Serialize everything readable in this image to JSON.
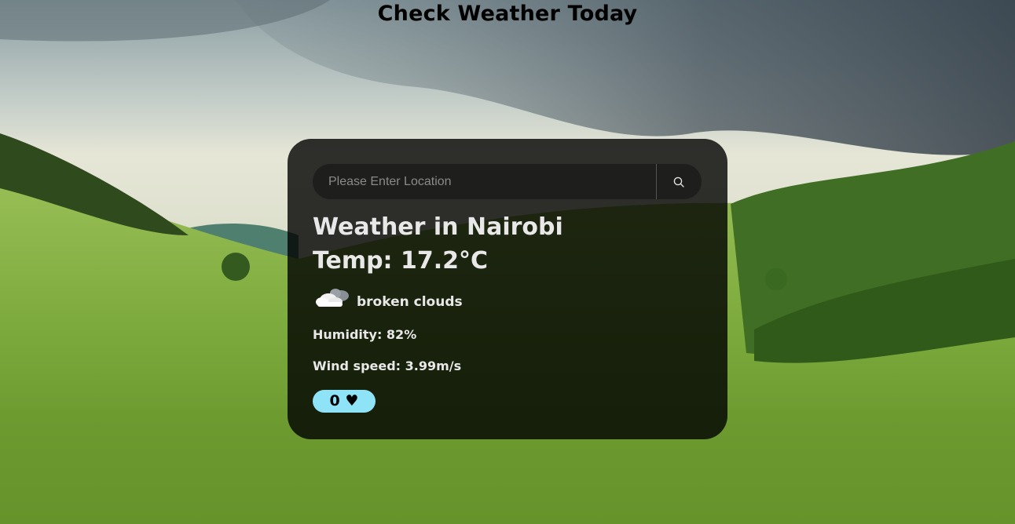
{
  "header": {
    "title": "Check Weather Today"
  },
  "search": {
    "placeholder": "Please Enter Location",
    "value": ""
  },
  "weather": {
    "city_line": "Weather in Nairobi",
    "temp_line": "Temp: 17.2°C",
    "icon": "broken-clouds-icon",
    "description": "broken clouds",
    "humidity_line": "Humidity: 82%",
    "wind_line": "Wind speed: 3.99m/s"
  },
  "like": {
    "count": "0",
    "symbol": "♥"
  },
  "colors": {
    "card_background": "#000000cc",
    "like_button": "#8fe3f7",
    "text": "#e8e8e8"
  }
}
